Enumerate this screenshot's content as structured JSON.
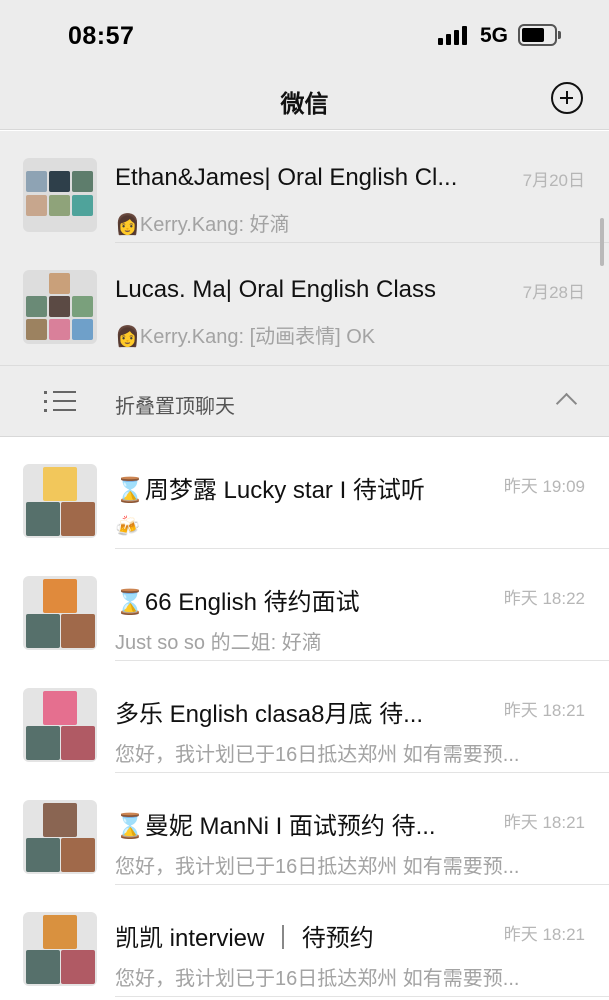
{
  "status_bar": {
    "time": "08:57",
    "network": "5G"
  },
  "nav": {
    "title": "微信",
    "add_icon": "plus-circle-icon"
  },
  "pinned_chats": [
    {
      "name": "Ethan&James| Oral English Cl...",
      "preview_prefix": "👩",
      "preview": "Kerry.Kang: 好滴",
      "time": "7月20日"
    },
    {
      "name": "Lucas. Ma| Oral English Class",
      "preview_prefix": "👩",
      "preview": "Kerry.Kang: [动画表情] OK",
      "time": "7月28日"
    }
  ],
  "fold_bar": {
    "label": "折叠置顶聊天",
    "icon": "list-icon",
    "chevron": "chevron-up-icon"
  },
  "chats": [
    {
      "hourglass": "⌛",
      "name": "周梦露 Lucky star I 待试听",
      "preview": "🍻",
      "time": "昨天 19:09"
    },
    {
      "hourglass": "⌛",
      "name": "66 English  待约面试",
      "preview": "Just so so 的二姐: 好滴",
      "time": "昨天 18:22"
    },
    {
      "hourglass": "",
      "name": "多乐 English clasa8月底 待...",
      "preview": "您好，我计划已于16日抵达郑州  如有需要预...",
      "time": "昨天 18:21"
    },
    {
      "hourglass": "⌛",
      "name": "曼妮 ManNi I 面试预约 待...",
      "preview": "您好，我计划已于16日抵达郑州  如有需要预...",
      "time": "昨天 18:21"
    },
    {
      "hourglass": "",
      "name": "凯凯 interview ｜ 待预约",
      "preview": "您好，我计划已于16日抵达郑州  如有需要预...",
      "time": "昨天 18:21"
    }
  ],
  "colors": {
    "pinned_bg": "#ededed",
    "nav_bg": "#ececec",
    "muted_text": "#a3a3a3"
  }
}
